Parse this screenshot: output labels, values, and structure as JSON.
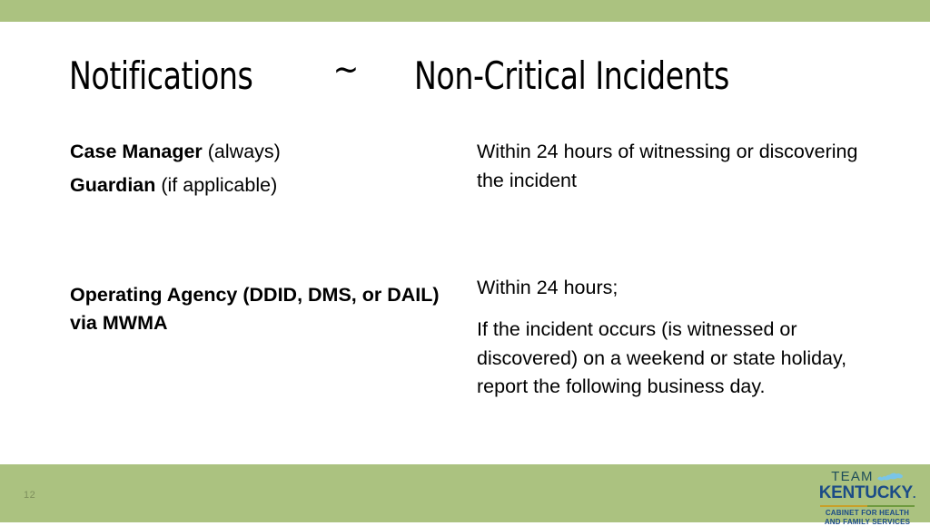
{
  "slide": {
    "page_number": "12",
    "colors": {
      "band_green": "#abc280",
      "background": "#ffffff",
      "text": "#000000",
      "page_number": "#7d8f5c",
      "logo_team": "#1f4e5a",
      "logo_kentucky": "#1b4b87",
      "logo_state": "#79c5e8",
      "logo_rule_gold": "#c8a02a",
      "logo_rule_green": "#6f9b3f"
    }
  },
  "title": {
    "left": "Notifications",
    "separator": "~",
    "right": "Non-Critical Incidents"
  },
  "rows": [
    {
      "left_lines": [
        {
          "bold": "Case Manager",
          "regular": " (always)"
        },
        {
          "bold": "Guardian",
          "regular": " (if applicable)"
        }
      ],
      "right_paragraphs": [
        "Within 24 hours of witnessing or discovering the incident"
      ]
    },
    {
      "left_lines": [
        {
          "bold": "Operating Agency (DDID, DMS, or DAIL) via MWMA",
          "regular": ""
        }
      ],
      "right_paragraphs": [
        "Within 24 hours;",
        "If the incident occurs (is witnessed or discovered) on a weekend or state holiday, report the following business day."
      ]
    }
  ],
  "logo": {
    "team": "TEAM",
    "kentucky": "KENTUCKY",
    "trademark": ".",
    "subtitle_line1": "CABINET FOR HEALTH",
    "subtitle_line2": "AND FAMILY SERVICES"
  }
}
